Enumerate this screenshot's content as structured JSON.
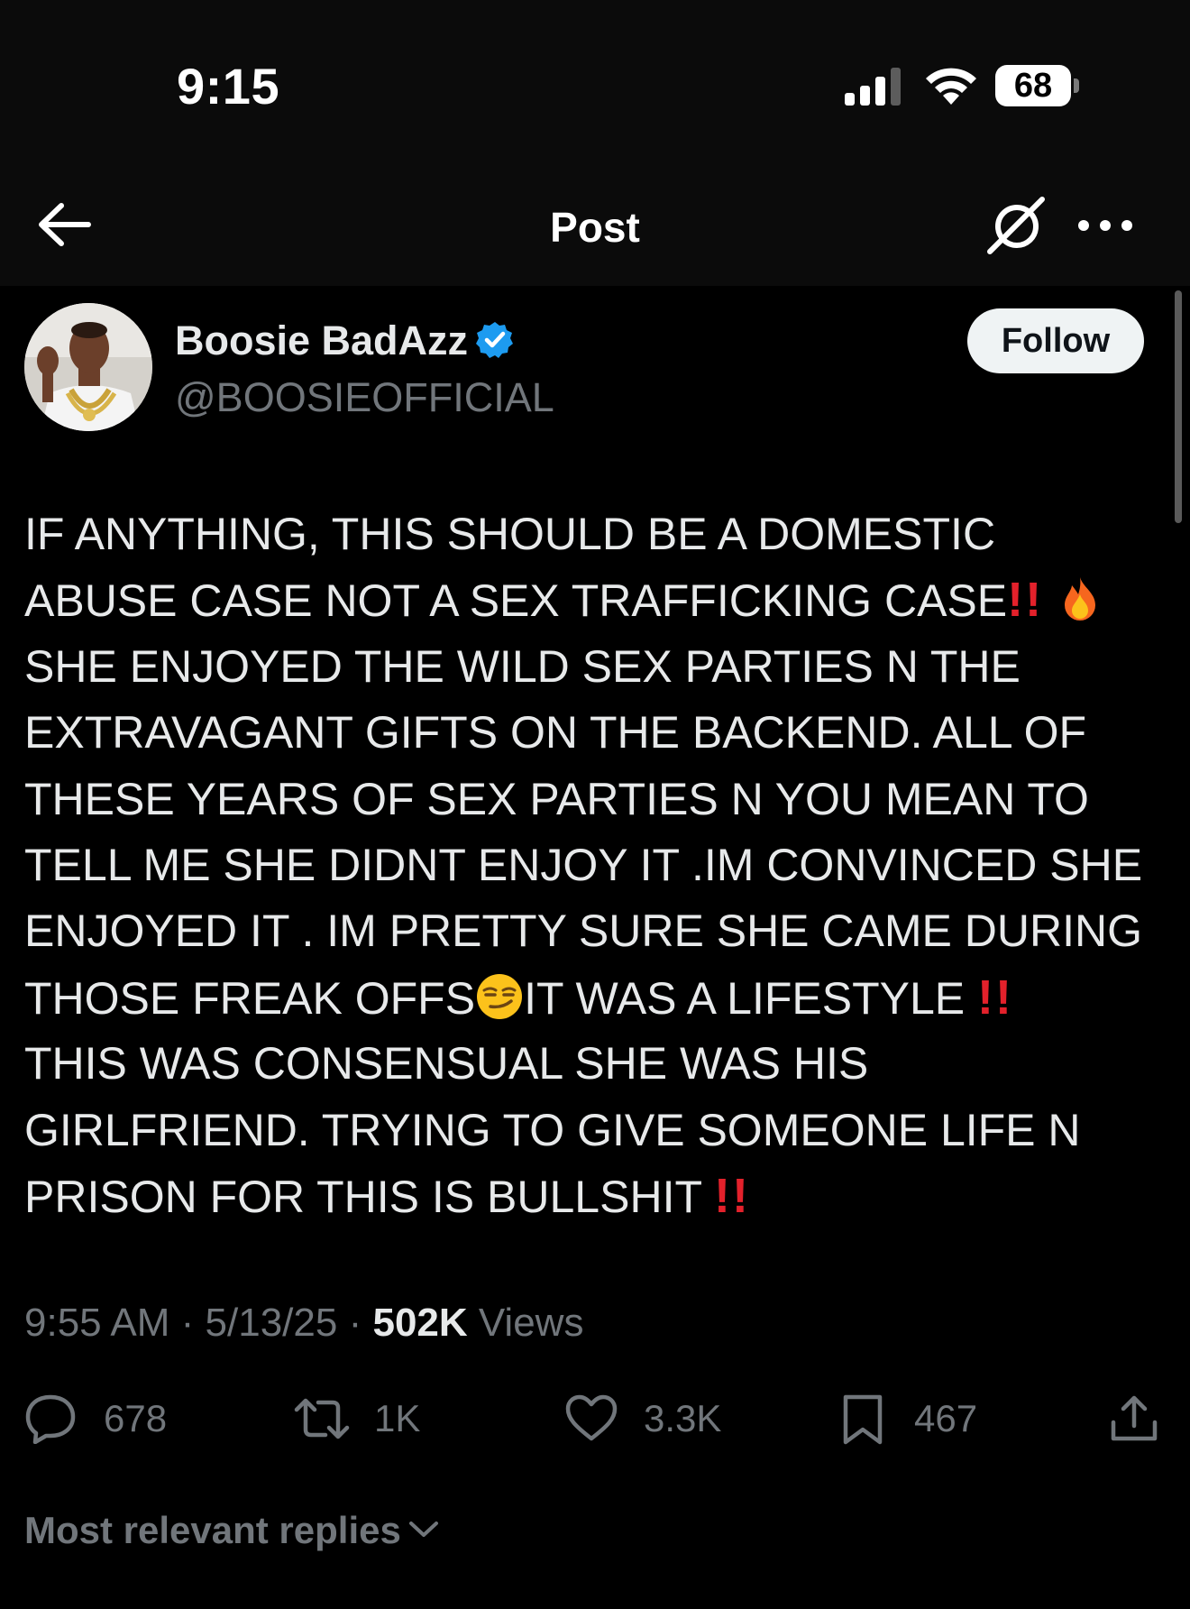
{
  "status_bar": {
    "time": "9:15",
    "battery": "68"
  },
  "nav": {
    "title": "Post",
    "icons": [
      "back-arrow-icon",
      "grok-icon",
      "more-icon"
    ]
  },
  "author": {
    "name": "Boosie BadAzz",
    "handle": "@BOOSIEOFFICIAL",
    "verified": true,
    "follow_label": "Follow"
  },
  "post": {
    "lines": [
      {
        "text": "IF ANYTHING, THIS SHOULD BE A DOMESTIC"
      },
      {
        "text": "ABUSE CASE NOT A SEX TRAFFICKING CASE",
        "after": "‼️ 🔥"
      },
      {
        "text": "SHE ENJOYED THE WILD SEX PARTIES N THE"
      },
      {
        "text": "EXTRAVAGANT GIFTS ON THE BACKEND. ALL OF"
      },
      {
        "text": "THESE YEARS OF SEX PARTIES N YOU MEAN TO"
      },
      {
        "text": "TELL ME SHE DIDNT ENJOY IT .IM CONVINCED SHE"
      },
      {
        "text": "ENJOYED IT . IM PRETTY SURE SHE CAME DURING"
      },
      {
        "text": "THOSE FREAK OFFS",
        "mid": "😏",
        "text2": "IT WAS A LIFESTYLE ",
        "after": "‼️"
      },
      {
        "text": "THIS WAS CONSENSUAL SHE WAS HIS"
      },
      {
        "text": "GIRLFRIEND. TRYING TO GIVE SOMEONE LIFE N"
      },
      {
        "text": "PRISON FOR THIS IS BULLSHIT ",
        "after": "‼️"
      }
    ]
  },
  "meta": {
    "time": "9:55 AM",
    "separator": " · ",
    "date": "5/13/25",
    "views_count": "502K",
    "views_label": " Views"
  },
  "actions": {
    "replies": "678",
    "reposts": "1K",
    "likes": "3.3K",
    "bookmarks": "467"
  },
  "replies_sort": {
    "label": "Most relevant replies"
  },
  "colors": {
    "background": "#000000",
    "text": "#e7e9ea",
    "muted": "#71767b",
    "verified": "#1d9bf0",
    "alert_red": "#e3212b"
  }
}
